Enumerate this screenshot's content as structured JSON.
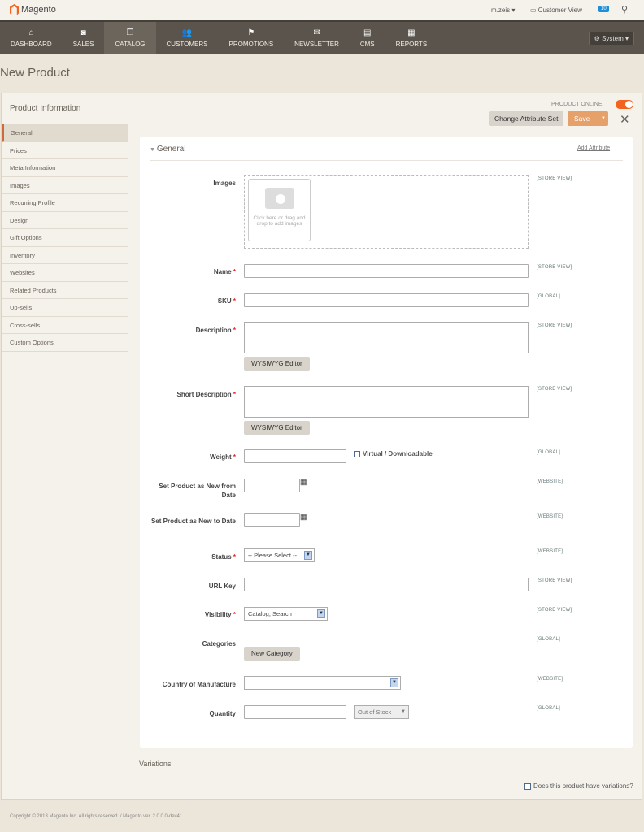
{
  "header": {
    "logo": "Magento",
    "user": "m.zeis ▾",
    "customer_view": "Customer View",
    "notifications": "10"
  },
  "nav": [
    {
      "label": "DASHBOARD",
      "icon": "home-icon",
      "g": "⌂"
    },
    {
      "label": "SALES",
      "icon": "sales-icon",
      "g": "◙"
    },
    {
      "label": "CATALOG",
      "icon": "catalog-icon",
      "g": "❐"
    },
    {
      "label": "CUSTOMERS",
      "icon": "customers-icon",
      "g": "👥"
    },
    {
      "label": "PROMOTIONS",
      "icon": "promotions-icon",
      "g": "⚑"
    },
    {
      "label": "NEWSLETTER",
      "icon": "newsletter-icon",
      "g": "✉"
    },
    {
      "label": "CMS",
      "icon": "cms-icon",
      "g": "▤"
    },
    {
      "label": "REPORTS",
      "icon": "reports-icon",
      "g": "▦"
    }
  ],
  "system": "System ▾",
  "page_title": "New Product",
  "sidebar": {
    "title": "Product Information",
    "items": [
      "General",
      "Prices",
      "Meta Information",
      "Images",
      "Recurring Profile",
      "Design",
      "Gift Options",
      "Inventory",
      "Websites",
      "Related Products",
      "Up-sells",
      "Cross-sells",
      "Custom Options"
    ]
  },
  "toolbar": {
    "product_online": "PRODUCT ONLINE",
    "change_attr": "Change Attribute Set",
    "save": "Save"
  },
  "section": {
    "title": "General",
    "add_attribute": "Add Attribute"
  },
  "form": {
    "images": {
      "label": "Images",
      "scope": "[STORE VIEW]",
      "hint": "Click here or drag and drop to add images"
    },
    "name": {
      "label": "Name",
      "scope": "[STORE VIEW]"
    },
    "sku": {
      "label": "SKU",
      "scope": "[GLOBAL]"
    },
    "description": {
      "label": "Description",
      "scope": "[STORE VIEW]",
      "button": "WYSIWYG Editor"
    },
    "short_description": {
      "label": "Short Description",
      "scope": "[STORE VIEW]",
      "button": "WYSIWYG Editor"
    },
    "weight": {
      "label": "Weight",
      "scope": "[GLOBAL]",
      "virtual": "Virtual / Downloadable"
    },
    "new_from": {
      "label": "Set Product as New from Date",
      "scope": "[WEBSITE]"
    },
    "new_to": {
      "label": "Set Product as New to Date",
      "scope": "[WEBSITE]"
    },
    "status": {
      "label": "Status",
      "scope": "[WEBSITE]",
      "value": "-- Please Select --"
    },
    "url_key": {
      "label": "URL Key",
      "scope": "[STORE VIEW]"
    },
    "visibility": {
      "label": "Visibility",
      "scope": "[STORE VIEW]",
      "value": "Catalog, Search"
    },
    "categories": {
      "label": "Categories",
      "scope": "[GLOBAL]",
      "button": "New Category"
    },
    "country": {
      "label": "Country of Manufacture",
      "scope": "[WEBSITE]",
      "value": ""
    },
    "quantity": {
      "label": "Quantity",
      "scope": "[GLOBAL]",
      "stock": "Out of Stock"
    }
  },
  "variations": {
    "title": "Variations",
    "question": "Does this product have variations?"
  },
  "footer": "Copyright © 2013 Magento Inc. All rights reserved. / Magento ver. 2.0.0.0-dev41"
}
